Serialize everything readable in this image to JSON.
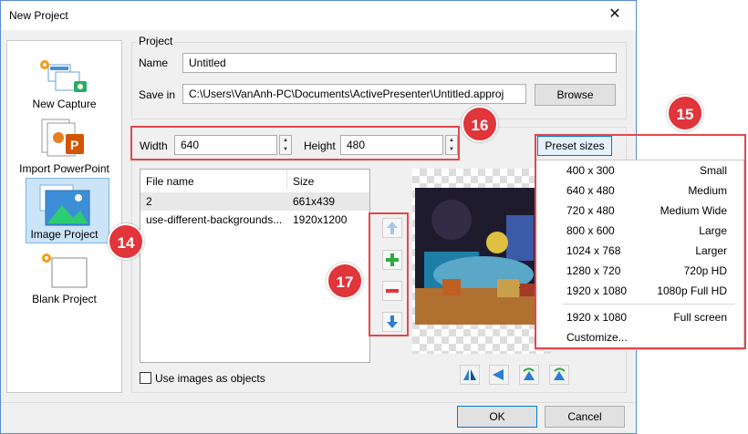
{
  "window": {
    "title": "New Project",
    "close": "✕"
  },
  "modes": [
    {
      "label": "New Capture"
    },
    {
      "label": "Import PowerPoint"
    },
    {
      "label": "Image Project"
    },
    {
      "label": "Blank Project"
    }
  ],
  "project": {
    "legend": "Project",
    "name_label": "Name",
    "name_value": "Untitled",
    "savein_label": "Save in",
    "savein_value": "C:\\Users\\VanAnh-PC\\Documents\\ActivePresenter\\Untitled.approj",
    "browse_label": "Browse"
  },
  "size": {
    "width_label": "Width",
    "width_value": "640",
    "height_label": "Height",
    "height_value": "480",
    "preset_label": "Preset sizes"
  },
  "file_list": {
    "columns": [
      "File name",
      "Size"
    ],
    "rows": [
      [
        "2",
        "661x439"
      ],
      [
        "use-different-backgrounds...",
        "1920x1200"
      ]
    ]
  },
  "use_images_label": "Use images as objects",
  "preset_menu": [
    {
      "size": "400 x 300",
      "name": "Small"
    },
    {
      "size": "640 x 480",
      "name": "Medium"
    },
    {
      "size": "720 x 480",
      "name": "Medium Wide"
    },
    {
      "size": "800 x 600",
      "name": "Large"
    },
    {
      "size": "1024 x 768",
      "name": "Larger"
    },
    {
      "size": "1280 x 720",
      "name": "720p HD"
    },
    {
      "size": "1920 x 1080",
      "name": "1080p Full HD"
    },
    {
      "size": "1920 x 1080",
      "name": "Full screen"
    },
    {
      "size": "Customize...",
      "name": ""
    }
  ],
  "callouts": {
    "c14": "14",
    "c15": "15",
    "c16": "16",
    "c17": "17"
  },
  "footer": {
    "ok": "OK",
    "cancel": "Cancel"
  },
  "colors": {
    "accent": "#0078d7",
    "callout": "#e0353b",
    "selection": "#cce4f7"
  }
}
